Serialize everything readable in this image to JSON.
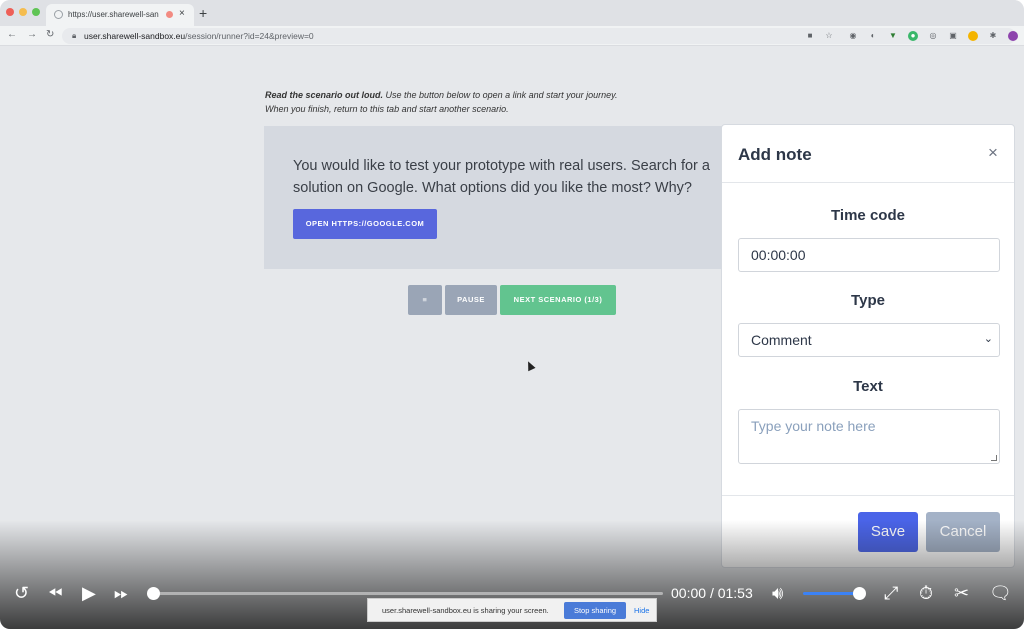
{
  "browser": {
    "tab_title": "https://user.sharewell-san",
    "tab_close": "×",
    "new_tab": "+",
    "url_host": "user.sharewell-sandbox.eu",
    "url_path": "/session/runner?id=24&preview=0"
  },
  "page": {
    "instruction_bold": "Read the scenario out loud.",
    "instruction_rest": " Use the button below to open a link and start your journey.",
    "instruction_line2": "When you finish, return to this tab and start another scenario.",
    "scenario_text": "You would like to test your prototype with real users. Search for a solution on Google. What options did you like the most? Why?",
    "open_button": "OPEN HTTPS://GOOGLE.COM",
    "menu_button": "≡",
    "pause_button": "PAUSE",
    "next_button": "NEXT SCENARIO (1/3)"
  },
  "modal": {
    "title": "Add note",
    "close": "×",
    "timecode_label": "Time code",
    "timecode_value": "00:00:00",
    "type_label": "Type",
    "type_value": "Comment",
    "text_label": "Text",
    "text_placeholder": "Type your note here",
    "save": "Save",
    "cancel": "Cancel"
  },
  "player": {
    "current_time": "00:00",
    "separator": "/",
    "duration": "01:53",
    "progress": 0.0,
    "volume": 0.9
  },
  "share_bar": {
    "text": "user.sharewell-sandbox.eu is sharing your screen.",
    "stop": "Stop sharing",
    "hide": "Hide"
  },
  "colors": {
    "primary": "#5867dd",
    "next_green": "#62c48f",
    "save_blue": "#4a64e8",
    "cancel_gray": "#a4b2c7"
  }
}
